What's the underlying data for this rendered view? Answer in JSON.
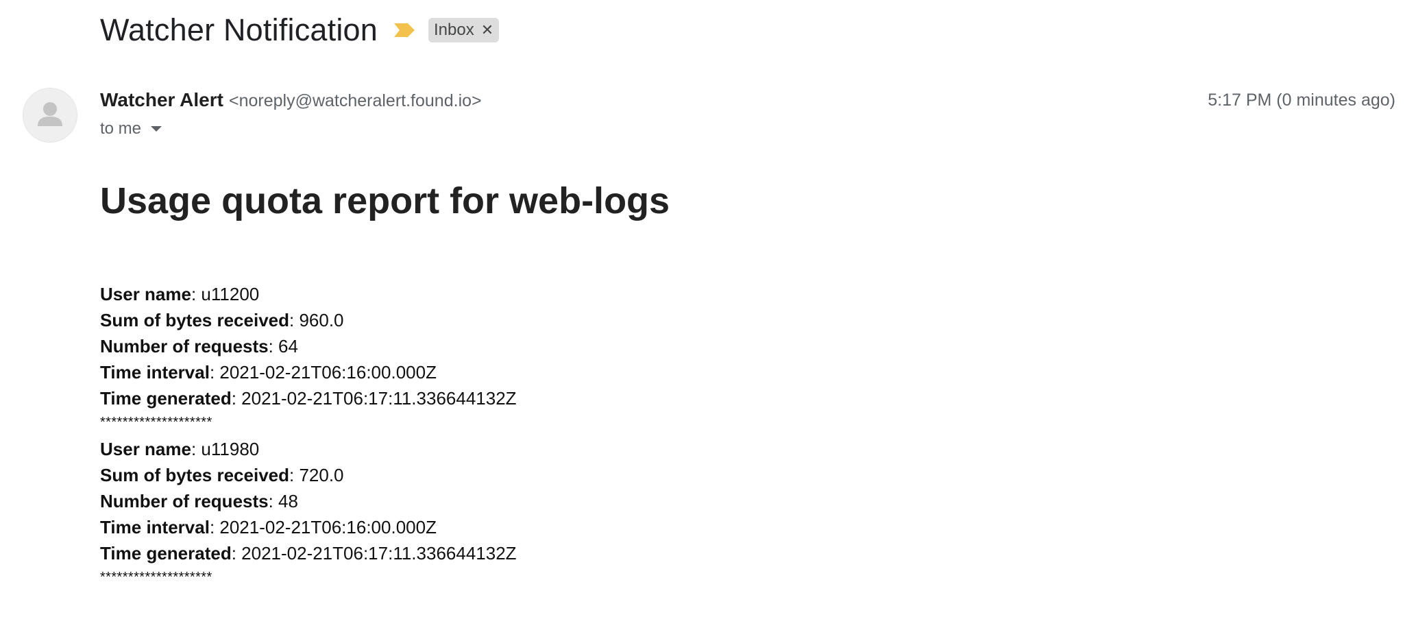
{
  "email": {
    "subject": "Watcher Notification",
    "label": "Inbox",
    "label_remove_icon": "close-icon",
    "importance_icon": "importance-marker-icon",
    "importance_color": "#f2c14e",
    "sender": {
      "name": "Watcher Alert",
      "address": "<noreply@watcheralert.found.io>",
      "avatar_icon": "person-icon"
    },
    "timestamp": "5:17 PM (0 minutes ago)",
    "recipient": "to me",
    "recipient_caret_icon": "caret-down-icon"
  },
  "body": {
    "title": "Usage quota report for web-logs",
    "records": [
      {
        "user_name_label": "User name",
        "user_name": ": u11200",
        "bytes_label": "Sum of bytes received",
        "bytes": ": 960.0",
        "requests_label": "Number of requests",
        "requests": ": 64",
        "interval_label": "Time interval",
        "interval": ": 2021-02-21T06:16:00.000Z",
        "generated_label": "Time generated",
        "generated": ": 2021-02-21T06:17:11.336644132Z",
        "separator": "********************"
      },
      {
        "user_name_label": "User name",
        "user_name": ": u11980",
        "bytes_label": "Sum of bytes received",
        "bytes": ": 720.0",
        "requests_label": "Number of requests",
        "requests": ": 48",
        "interval_label": "Time interval",
        "interval": ": 2021-02-21T06:16:00.000Z",
        "generated_label": "Time generated",
        "generated": ": 2021-02-21T06:17:11.336644132Z",
        "separator": "********************"
      }
    ]
  }
}
